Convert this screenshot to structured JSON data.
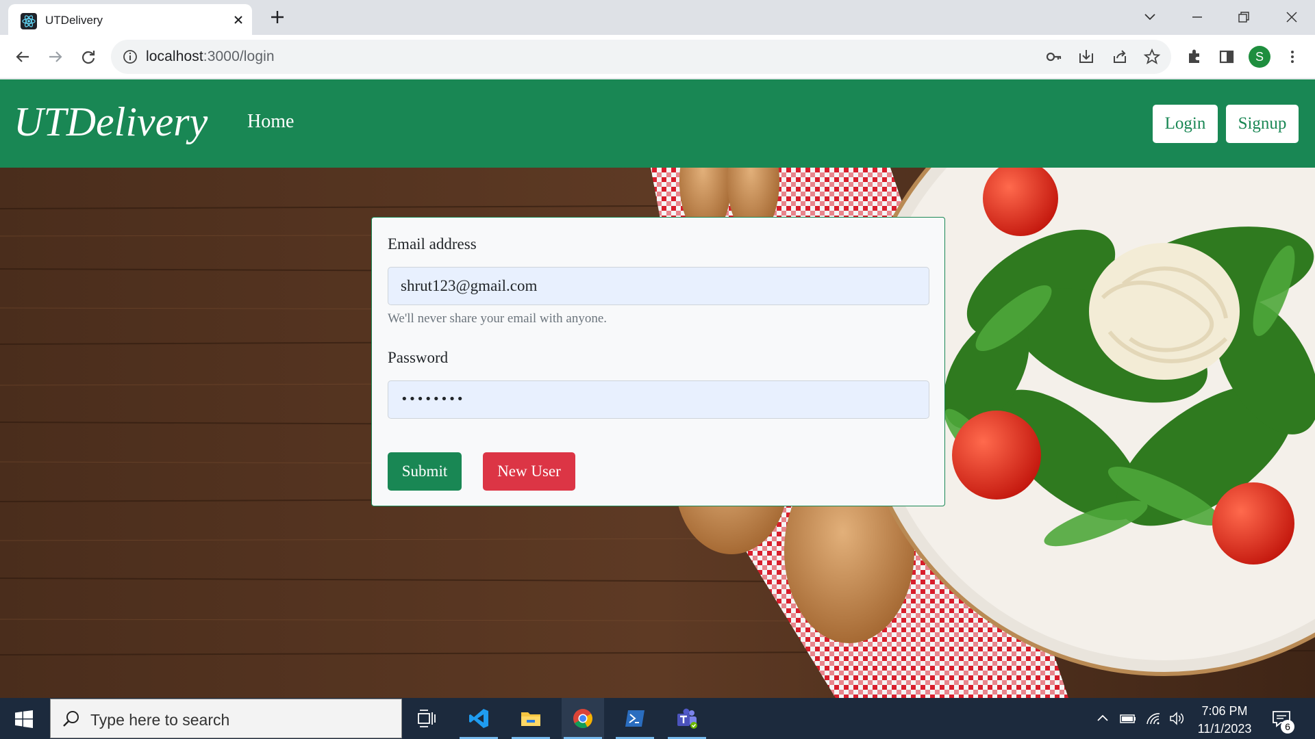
{
  "browser": {
    "tab_title": "UTDelivery",
    "url_host": "localhost",
    "url_rest": ":3000/login",
    "profile_initial": "S"
  },
  "navbar": {
    "brand": "UTDelivery",
    "home": "Home",
    "login": "Login",
    "signup": "Signup",
    "color": "#198754"
  },
  "form": {
    "email_label": "Email address",
    "email_value": "shrut123@gmail.com",
    "email_help": "We'll never share your email with anyone.",
    "password_label": "Password",
    "password_value": "••••••••",
    "submit": "Submit",
    "new_user": "New User",
    "submit_color": "#198754",
    "new_user_color": "#dc3545"
  },
  "taskbar": {
    "search_placeholder": "Type here to search",
    "time": "7:06 PM",
    "date": "11/1/2023",
    "notification_count": "6",
    "apps": [
      "task-view-icon",
      "vscode-icon",
      "file-explorer-icon",
      "chrome-icon",
      "powershell-icon",
      "teams-icon"
    ]
  }
}
